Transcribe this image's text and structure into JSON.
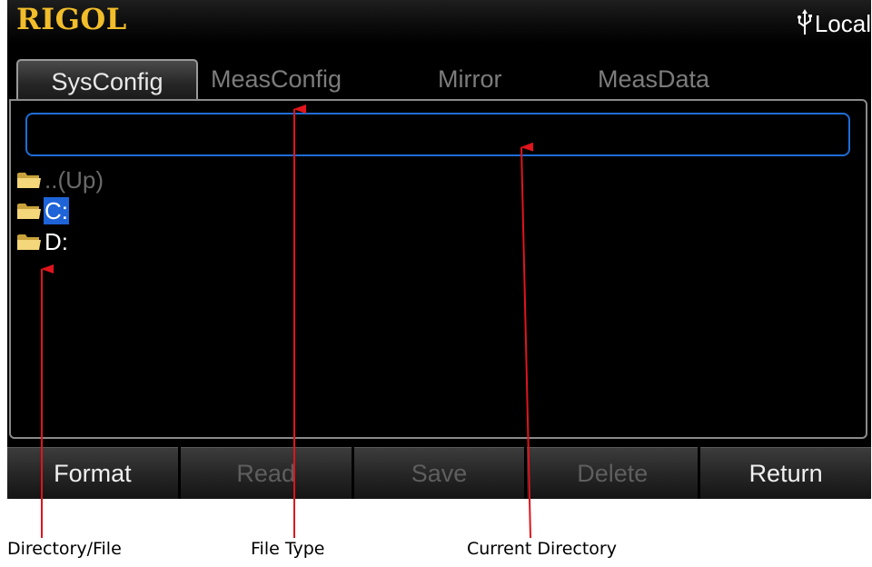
{
  "header": {
    "logo": "RIGOL",
    "status_label": "Local",
    "status_icon": "usb-icon",
    "logo_color": "#f2bd2a"
  },
  "tabs": [
    {
      "label": "SysConfig",
      "active": true
    },
    {
      "label": "MeasConfig",
      "active": false
    },
    {
      "label": "Mirror",
      "active": false
    },
    {
      "label": "MeasData",
      "active": false
    }
  ],
  "current_directory": {
    "value": ""
  },
  "files": [
    {
      "label": "..(Up)",
      "icon": "folder-icon",
      "state": "disabled"
    },
    {
      "label": "C:",
      "icon": "folder-icon",
      "state": "selected"
    },
    {
      "label": "D:",
      "icon": "folder-icon",
      "state": "normal"
    }
  ],
  "softkeys": [
    {
      "label": "Format",
      "enabled": true
    },
    {
      "label": "Read",
      "enabled": false
    },
    {
      "label": "Save",
      "enabled": false
    },
    {
      "label": "Delete",
      "enabled": false
    },
    {
      "label": "Return",
      "enabled": true
    }
  ],
  "callouts": {
    "directory_file": "Directory/File",
    "file_type": "File Type",
    "current_directory": "Current Directory"
  },
  "colors": {
    "selection": "#1e63d8",
    "field_border": "#1f6cd6",
    "arrow": "#e0141c"
  }
}
